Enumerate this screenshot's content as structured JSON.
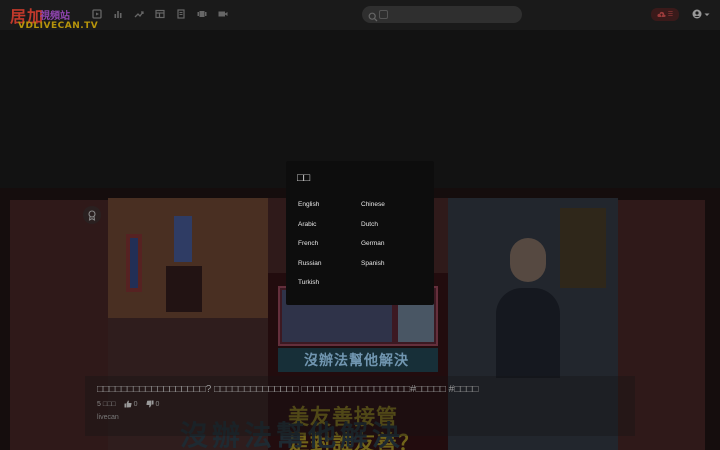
{
  "header": {
    "logo_main": "居加",
    "logo_sub": "視頻站",
    "logo_tag": "VDLIVECAN.TV",
    "nav_icons": [
      "video-library-icon",
      "bar-chart-icon",
      "trending-icon",
      "layout-icon",
      "list-icon",
      "stack-icon",
      "live-camera-icon"
    ],
    "search": {
      "placeholder": ""
    },
    "upload_label": "☰",
    "accent": "#c0392b"
  },
  "hero": {
    "mid_caption": "沒辦法幫他解決",
    "mid_big_title_line1": "美友善接管",
    "mid_big_title_line2": "是對誰友善？",
    "bottom_overlay": "沒辦法幫他解決"
  },
  "video": {
    "title": "□□□□□□□□□□□□□□□□□□? □□□□□□□□□□□□□□ □□□□□□□□□□□□□□□□□□#□□□□□ #□□□□",
    "views": "5",
    "views_unit": "□□□",
    "likes": "0",
    "dislikes": "0",
    "channel": "livecan"
  },
  "language_popup": {
    "title": "□□",
    "languages": [
      "English",
      "Chinese",
      "Arabic",
      "Dutch",
      "French",
      "German",
      "Russian",
      "Spanish",
      "Turkish"
    ]
  }
}
